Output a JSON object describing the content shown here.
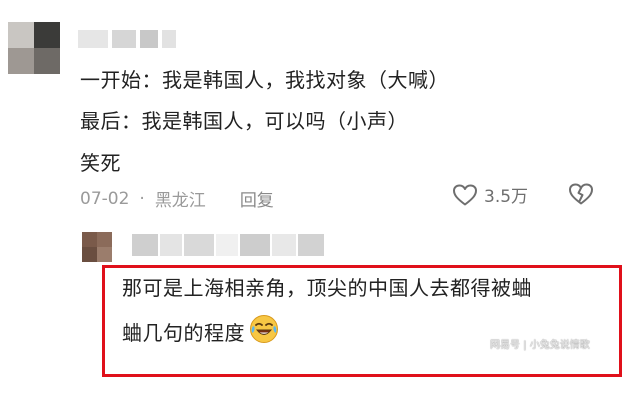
{
  "comment1": {
    "lines": [
      "一开始：我是韩国人，我找对象（大喊）",
      "最后：我是韩国人，可以吗（小声）",
      "笑死"
    ],
    "date": "07-02",
    "separator": "·",
    "location": "黑龙江",
    "reply_label": "回复",
    "like_count": "3.5万",
    "icons": [
      "heart-outline-icon",
      "broken-heart-icon"
    ]
  },
  "comment2": {
    "line1": "那可是上海相亲角，顶尖的中国人去都得被蛐",
    "line2": "蛐几句的程度",
    "emoji": "laughing-crying-emoji",
    "highlight_color": "#e0101a"
  },
  "watermark": "网易号 | 小兔兔说情歌"
}
